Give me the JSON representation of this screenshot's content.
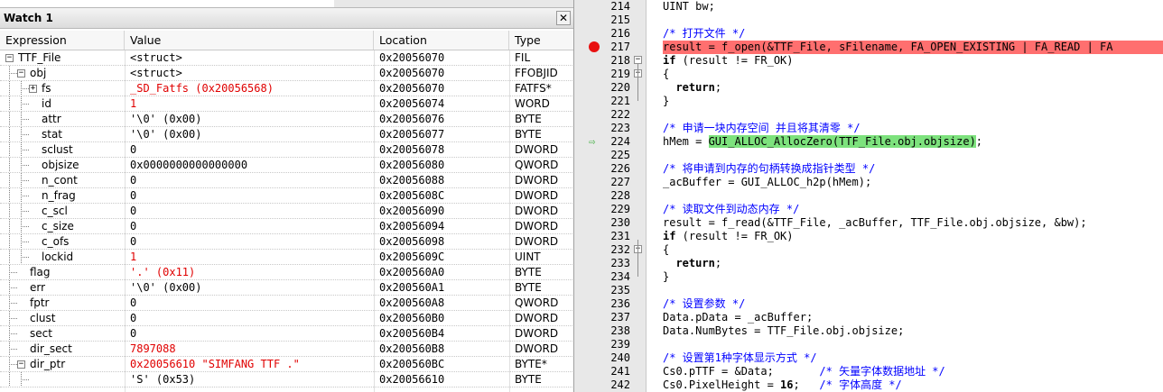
{
  "watch": {
    "title": "Watch 1",
    "close_glyph": "✕",
    "columns": [
      "Expression",
      "Value",
      "Location",
      "Type"
    ],
    "rows": [
      {
        "depth": 0,
        "toggle": "-",
        "expr": "TTF_File",
        "value": "<struct>",
        "loc": "0x20056070",
        "type": "FIL",
        "red": false
      },
      {
        "depth": 1,
        "toggle": "-",
        "expr": "obj",
        "value": "<struct>",
        "loc": "0x20056070",
        "type": "FFOBJID",
        "red": false
      },
      {
        "depth": 2,
        "toggle": "+",
        "expr": "fs",
        "value": "_SD_Fatfs (0x20056568)",
        "loc": "0x20056070",
        "type": "FATFS*",
        "red": true
      },
      {
        "depth": 2,
        "toggle": "",
        "expr": "id",
        "value": "1",
        "loc": "0x20056074",
        "type": "WORD",
        "red": true
      },
      {
        "depth": 2,
        "toggle": "",
        "expr": "attr",
        "value": "'\\0' (0x00)",
        "loc": "0x20056076",
        "type": "BYTE",
        "red": false
      },
      {
        "depth": 2,
        "toggle": "",
        "expr": "stat",
        "value": "'\\0' (0x00)",
        "loc": "0x20056077",
        "type": "BYTE",
        "red": false
      },
      {
        "depth": 2,
        "toggle": "",
        "expr": "sclust",
        "value": "0",
        "loc": "0x20056078",
        "type": "DWORD",
        "red": false
      },
      {
        "depth": 2,
        "toggle": "",
        "expr": "objsize",
        "value": "0x0000000000000000",
        "loc": "0x20056080",
        "type": "QWORD",
        "red": false
      },
      {
        "depth": 2,
        "toggle": "",
        "expr": "n_cont",
        "value": "0",
        "loc": "0x20056088",
        "type": "DWORD",
        "red": false
      },
      {
        "depth": 2,
        "toggle": "",
        "expr": "n_frag",
        "value": "0",
        "loc": "0x2005608C",
        "type": "DWORD",
        "red": false
      },
      {
        "depth": 2,
        "toggle": "",
        "expr": "c_scl",
        "value": "0",
        "loc": "0x20056090",
        "type": "DWORD",
        "red": false
      },
      {
        "depth": 2,
        "toggle": "",
        "expr": "c_size",
        "value": "0",
        "loc": "0x20056094",
        "type": "DWORD",
        "red": false
      },
      {
        "depth": 2,
        "toggle": "",
        "expr": "c_ofs",
        "value": "0",
        "loc": "0x20056098",
        "type": "DWORD",
        "red": false
      },
      {
        "depth": 2,
        "toggle": "",
        "expr": "lockid",
        "value": "1",
        "loc": "0x2005609C",
        "type": "UINT",
        "red": true
      },
      {
        "depth": 1,
        "toggle": "",
        "expr": "flag",
        "value": "'.' (0x11)",
        "loc": "0x200560A0",
        "type": "BYTE",
        "red": true
      },
      {
        "depth": 1,
        "toggle": "",
        "expr": "err",
        "value": "'\\0' (0x00)",
        "loc": "0x200560A1",
        "type": "BYTE",
        "red": false
      },
      {
        "depth": 1,
        "toggle": "",
        "expr": "fptr",
        "value": "0",
        "loc": "0x200560A8",
        "type": "QWORD",
        "red": false
      },
      {
        "depth": 1,
        "toggle": "",
        "expr": "clust",
        "value": "0",
        "loc": "0x200560B0",
        "type": "DWORD",
        "red": false
      },
      {
        "depth": 1,
        "toggle": "",
        "expr": "sect",
        "value": "0",
        "loc": "0x200560B4",
        "type": "DWORD",
        "red": false
      },
      {
        "depth": 1,
        "toggle": "",
        "expr": "dir_sect",
        "value": "7897088",
        "loc": "0x200560B8",
        "type": "DWORD",
        "red": true
      },
      {
        "depth": 1,
        "toggle": "-",
        "expr": "dir_ptr",
        "value": "0x20056610 \"SIMFANG TTF .\"",
        "loc": "0x200560BC",
        "type": "BYTE*",
        "red": true
      },
      {
        "depth": 2,
        "toggle": "",
        "expr": "",
        "value": "'S' (0x53)",
        "loc": "0x20056610",
        "type": "BYTE",
        "red": false
      }
    ]
  },
  "editor": {
    "lines": [
      {
        "n": "214",
        "code": "UINT bw;",
        "kind": "code"
      },
      {
        "n": "215",
        "code": "",
        "kind": "code"
      },
      {
        "n": "216",
        "code": "/* 打开文件 */",
        "kind": "comment"
      },
      {
        "n": "217",
        "code": "result = f_open(&TTF_File, sFilename, FA_OPEN_EXISTING | FA_READ | FA",
        "kind": "breakpoint"
      },
      {
        "n": "218",
        "code": "if (result != FR_OK)",
        "kind": "if",
        "fold": "-"
      },
      {
        "n": "219",
        "code": "{",
        "kind": "code",
        "fold": "-"
      },
      {
        "n": "220",
        "code": "  return;",
        "kind": "return"
      },
      {
        "n": "221",
        "code": "}",
        "kind": "code",
        "foldend": true
      },
      {
        "n": "222",
        "code": "",
        "kind": "code"
      },
      {
        "n": "223",
        "code": "/* 申请一块内存空间 并且将其清零 */",
        "kind": "comment"
      },
      {
        "n": "224",
        "code": "hMem = ",
        "code_hl": "GUI_ALLOC_AllocZero(TTF_File.obj.objsize)",
        "code_tail": ";",
        "kind": "current"
      },
      {
        "n": "225",
        "code": "",
        "kind": "code"
      },
      {
        "n": "226",
        "code": "/* 将申请到内存的句柄转换成指针类型 */",
        "kind": "comment"
      },
      {
        "n": "227",
        "code": "_acBuffer = GUI_ALLOC_h2p(hMem);",
        "kind": "code"
      },
      {
        "n": "228",
        "code": "",
        "kind": "code"
      },
      {
        "n": "229",
        "code": "/* 读取文件到动态内存 */",
        "kind": "comment"
      },
      {
        "n": "230",
        "code": "result = f_read(&TTF_File, _acBuffer, TTF_File.obj.objsize, &bw);",
        "kind": "code"
      },
      {
        "n": "231",
        "code": "if (result != FR_OK)",
        "kind": "if"
      },
      {
        "n": "232",
        "code": "{",
        "kind": "code",
        "fold": "-"
      },
      {
        "n": "233",
        "code": "  return;",
        "kind": "return"
      },
      {
        "n": "234",
        "code": "}",
        "kind": "code",
        "foldend": true
      },
      {
        "n": "235",
        "code": "",
        "kind": "code"
      },
      {
        "n": "236",
        "code": "/* 设置参数 */",
        "kind": "comment"
      },
      {
        "n": "237",
        "code": "Data.pData = _acBuffer;",
        "kind": "code"
      },
      {
        "n": "238",
        "code": "Data.NumBytes = TTF_File.obj.objsize;",
        "kind": "code"
      },
      {
        "n": "239",
        "code": "",
        "kind": "code"
      },
      {
        "n": "240",
        "code": "/* 设置第1种字体显示方式 */",
        "kind": "comment"
      },
      {
        "n": "241",
        "code": "Cs0.pTTF = &Data;       ",
        "code_tail_cmt": "/* 矢量字体数据地址 */",
        "kind": "mixed"
      },
      {
        "n": "242",
        "code": "Cs0.PixelHeight = ",
        "code_bold": "16",
        "code_rest": ";   ",
        "code_tail_cmt": "/* 字体高度 */",
        "kind": "mixed2"
      }
    ]
  }
}
